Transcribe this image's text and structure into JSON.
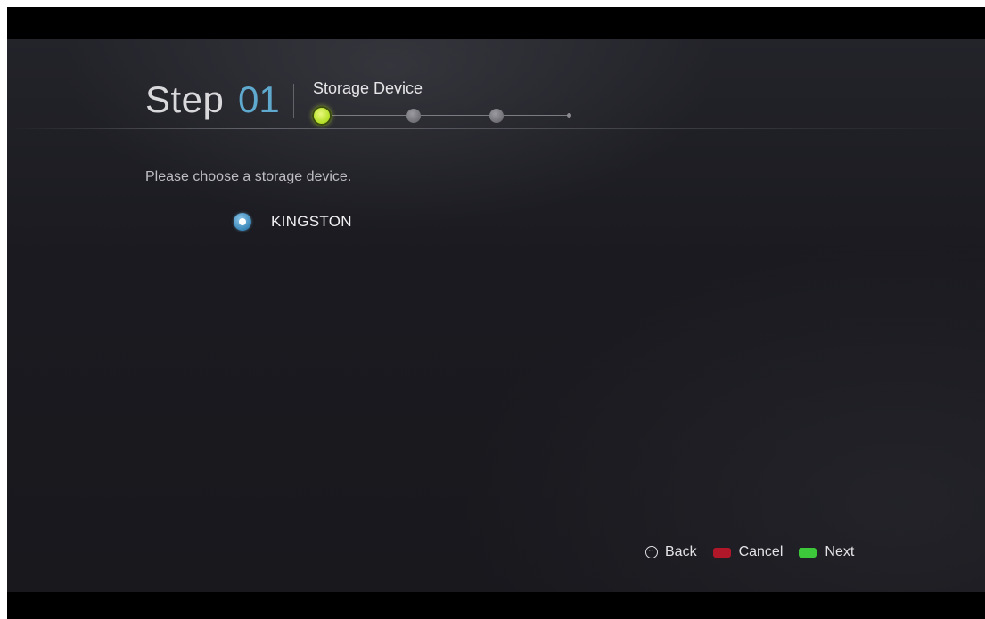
{
  "header": {
    "step_word": "Step",
    "step_number": "01",
    "step_title": "Storage Device",
    "progress": {
      "current_step": 1,
      "total_steps": 3
    }
  },
  "content": {
    "prompt": "Please choose a storage device.",
    "options": [
      {
        "label": "KINGSTON",
        "selected": true
      }
    ]
  },
  "footer": {
    "back_label": "Back",
    "cancel_label": "Cancel",
    "next_label": "Next"
  },
  "colors": {
    "step_number": "#5fa9cf",
    "active_step": "#b6e02a",
    "cancel_key": "#b0182a",
    "next_key": "#3cc83a",
    "radio": "#3a86b8"
  },
  "icons": {
    "back": "back-circle-icon",
    "cancel": "red-key-icon",
    "next": "green-key-icon",
    "radio": "radio-selected-icon"
  }
}
